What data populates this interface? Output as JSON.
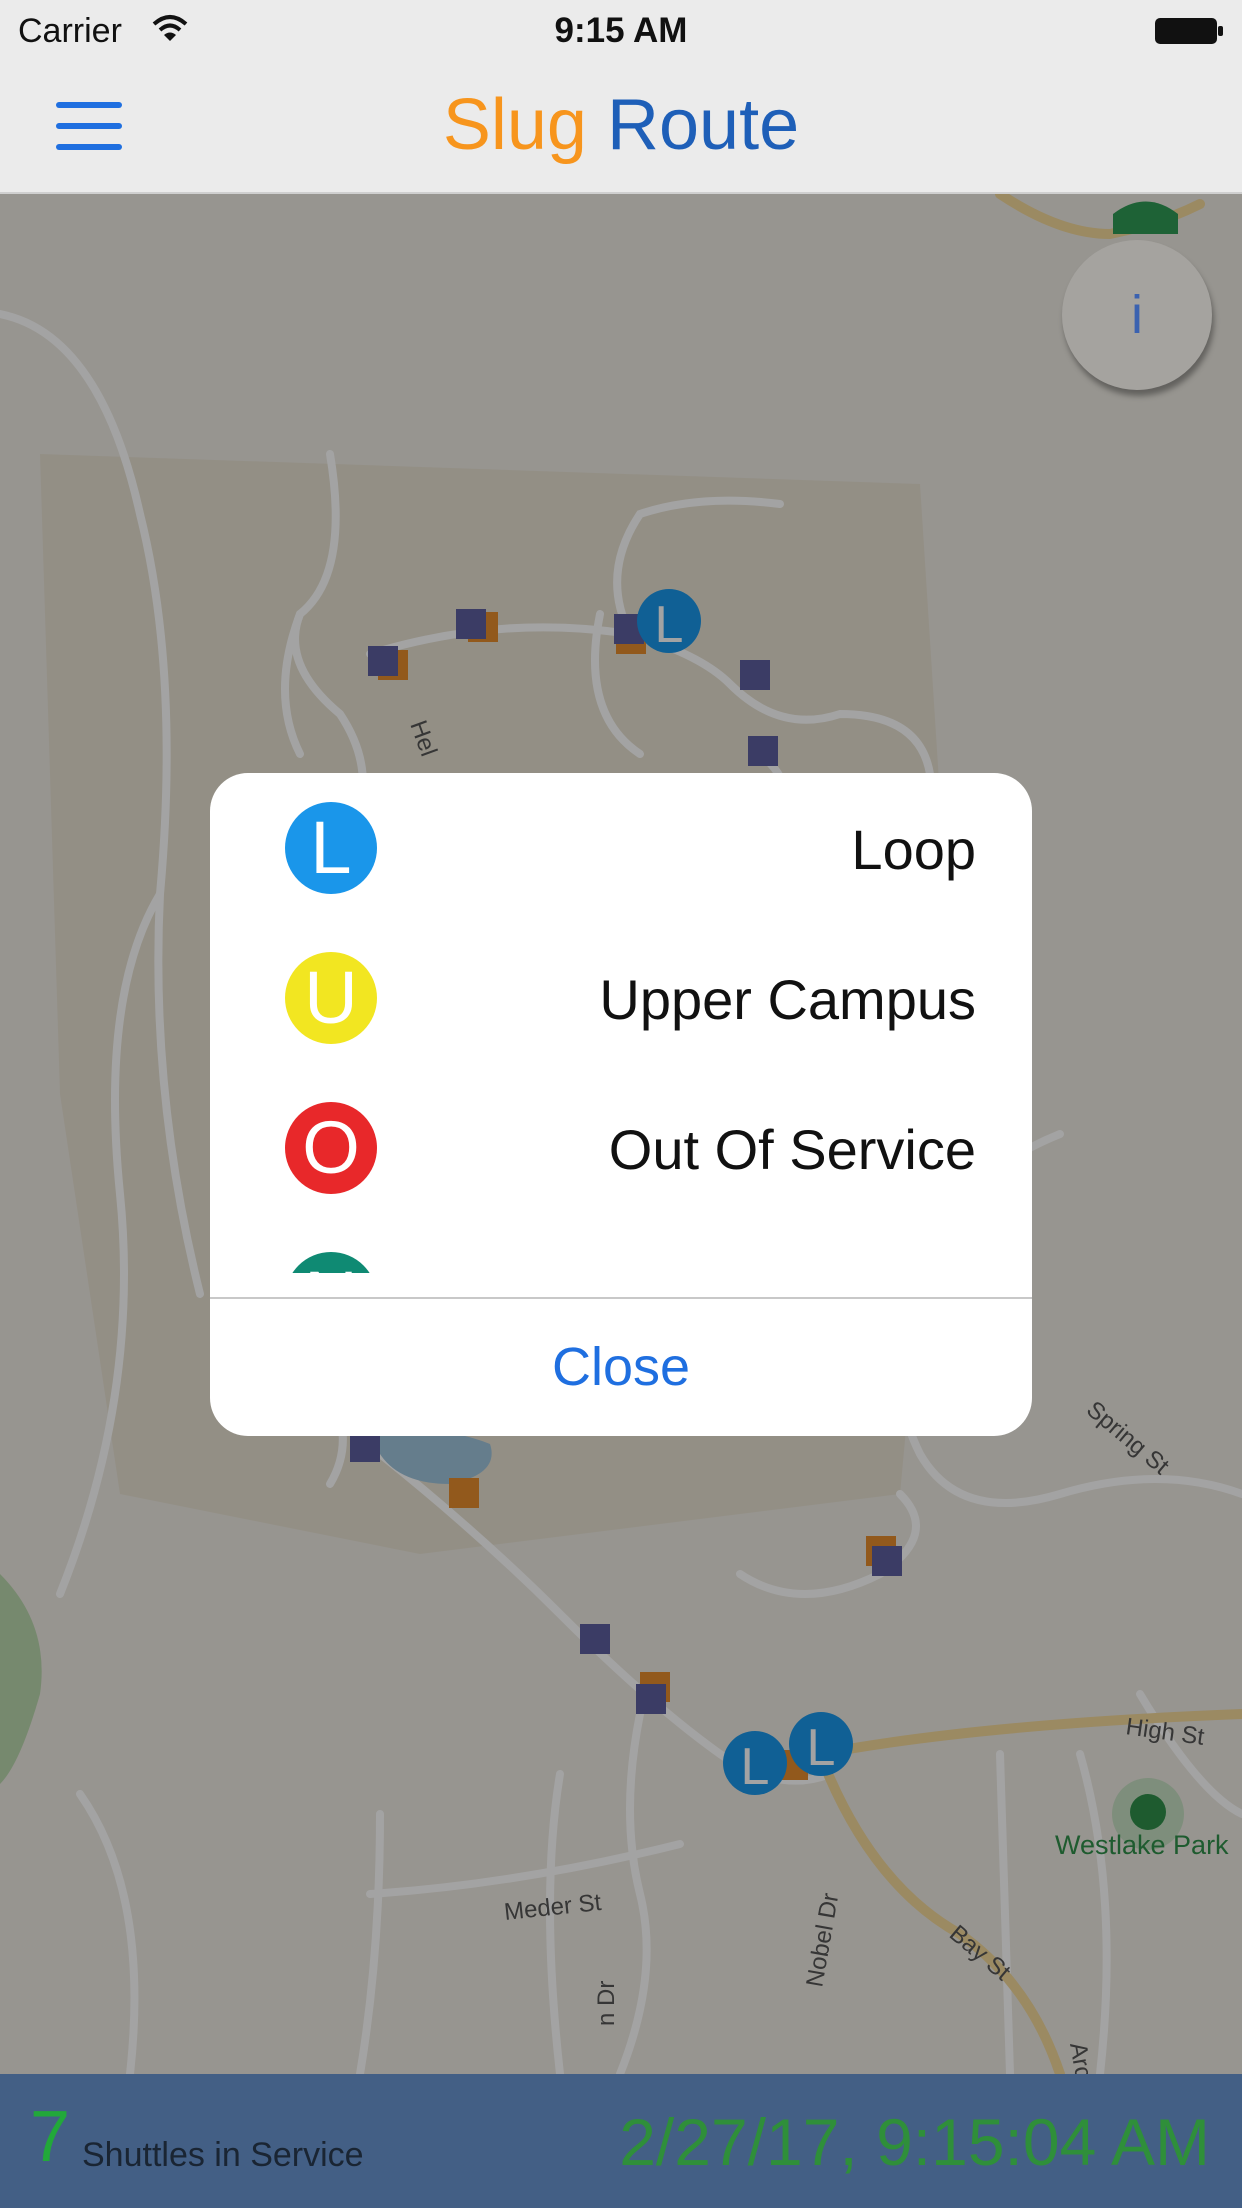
{
  "status_bar": {
    "carrier": "Carrier",
    "time": "9:15 AM"
  },
  "header": {
    "title_part1": "Slug",
    "title_part2": "Route",
    "title_color1": "#f7951d",
    "title_color2": "#1e5fb8",
    "menu_icon": "hamburger-menu-icon"
  },
  "map": {
    "street_labels": [
      "High St",
      "Westlake Park",
      "Meder St",
      "Bay St",
      "Nobel Dr",
      "Archer Dr",
      "Spring St",
      "Hel",
      "n Dr"
    ],
    "info_button_label": "i",
    "shuttle_marker_label": "L"
  },
  "dialog": {
    "items": [
      {
        "letter": "L",
        "label": "Loop",
        "color": "#1a96ea"
      },
      {
        "letter": "U",
        "label": "Upper Campus",
        "color": "#f2e621"
      },
      {
        "letter": "O",
        "label": "Out Of Service",
        "color": "#e8282a"
      },
      {
        "letter": "N",
        "label": "",
        "color": "#0f8a73"
      }
    ],
    "close_label": "Close"
  },
  "footer": {
    "count": "7",
    "count_label": "Shuttles in Service",
    "timestamp": "2/27/17, 9:15:04 AM"
  }
}
